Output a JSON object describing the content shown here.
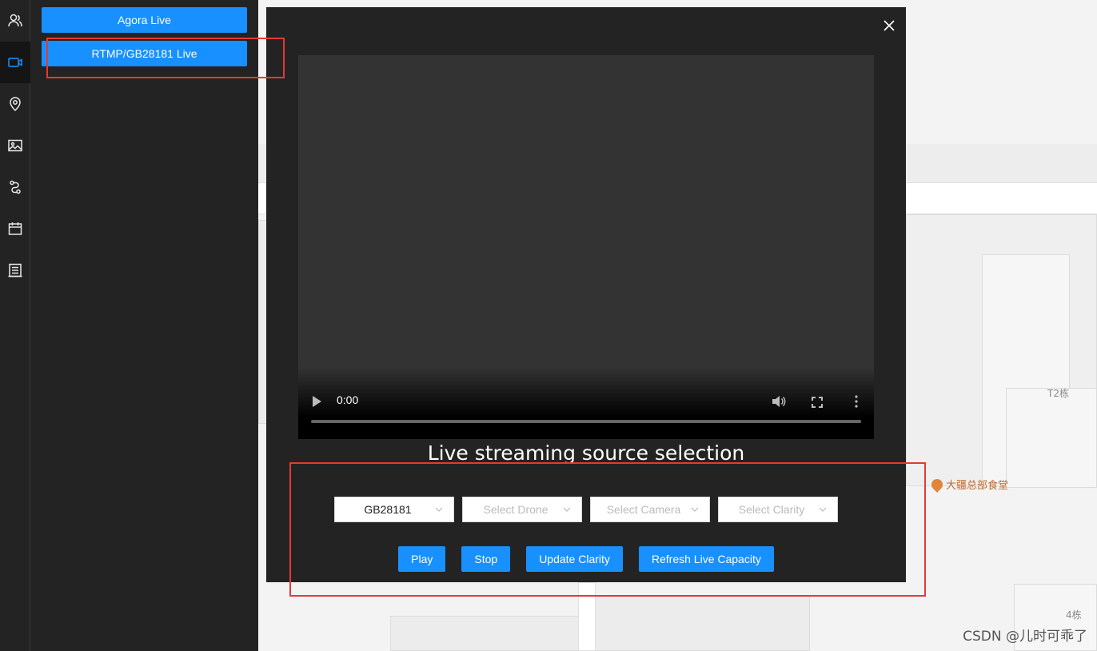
{
  "rail": {
    "icons": [
      "users-icon",
      "video-camera-icon",
      "location-pin-icon",
      "image-icon",
      "route-icon",
      "calendar-icon",
      "list-icon"
    ],
    "active_index": 1,
    "accent": "#1890ff"
  },
  "panel": {
    "agora_label": "Agora Live",
    "rtmp_label": "RTMP/GB28181 Live"
  },
  "video": {
    "time": "0:00"
  },
  "modal": {
    "title": "Live streaming source selection",
    "source_value": "GB28181",
    "drone_placeholder": "Select Drone",
    "camera_placeholder": "Select Camera",
    "clarity_placeholder": "Select Clarity",
    "buttons": {
      "play": "Play",
      "stop": "Stop",
      "update_clarity": "Update Clarity",
      "refresh": "Refresh Live Capacity"
    }
  },
  "map": {
    "label_t2": "T2栋",
    "label_4": "4栋",
    "poi": "大疆总部食堂"
  },
  "watermark": "CSDN @儿时可乖了",
  "colors": {
    "highlight": "#e53935",
    "button": "#1890ff",
    "panel_bg": "#232323"
  }
}
